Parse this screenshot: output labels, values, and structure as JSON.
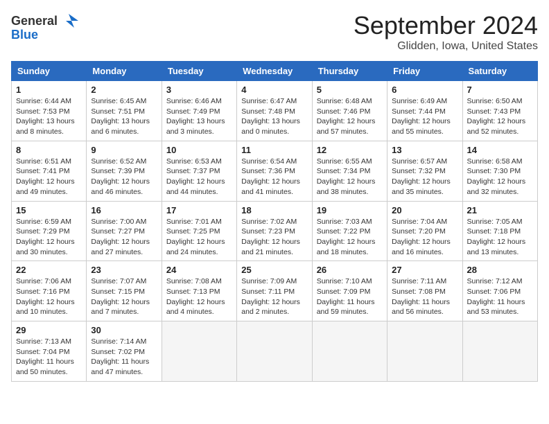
{
  "header": {
    "logo_general": "General",
    "logo_blue": "Blue",
    "month": "September 2024",
    "location": "Glidden, Iowa, United States"
  },
  "columns": [
    "Sunday",
    "Monday",
    "Tuesday",
    "Wednesday",
    "Thursday",
    "Friday",
    "Saturday"
  ],
  "weeks": [
    [
      {
        "day": "1",
        "info": "Sunrise: 6:44 AM\nSunset: 7:53 PM\nDaylight: 13 hours\nand 8 minutes."
      },
      {
        "day": "2",
        "info": "Sunrise: 6:45 AM\nSunset: 7:51 PM\nDaylight: 13 hours\nand 6 minutes."
      },
      {
        "day": "3",
        "info": "Sunrise: 6:46 AM\nSunset: 7:49 PM\nDaylight: 13 hours\nand 3 minutes."
      },
      {
        "day": "4",
        "info": "Sunrise: 6:47 AM\nSunset: 7:48 PM\nDaylight: 13 hours\nand 0 minutes."
      },
      {
        "day": "5",
        "info": "Sunrise: 6:48 AM\nSunset: 7:46 PM\nDaylight: 12 hours\nand 57 minutes."
      },
      {
        "day": "6",
        "info": "Sunrise: 6:49 AM\nSunset: 7:44 PM\nDaylight: 12 hours\nand 55 minutes."
      },
      {
        "day": "7",
        "info": "Sunrise: 6:50 AM\nSunset: 7:43 PM\nDaylight: 12 hours\nand 52 minutes."
      }
    ],
    [
      {
        "day": "8",
        "info": "Sunrise: 6:51 AM\nSunset: 7:41 PM\nDaylight: 12 hours\nand 49 minutes."
      },
      {
        "day": "9",
        "info": "Sunrise: 6:52 AM\nSunset: 7:39 PM\nDaylight: 12 hours\nand 46 minutes."
      },
      {
        "day": "10",
        "info": "Sunrise: 6:53 AM\nSunset: 7:37 PM\nDaylight: 12 hours\nand 44 minutes."
      },
      {
        "day": "11",
        "info": "Sunrise: 6:54 AM\nSunset: 7:36 PM\nDaylight: 12 hours\nand 41 minutes."
      },
      {
        "day": "12",
        "info": "Sunrise: 6:55 AM\nSunset: 7:34 PM\nDaylight: 12 hours\nand 38 minutes."
      },
      {
        "day": "13",
        "info": "Sunrise: 6:57 AM\nSunset: 7:32 PM\nDaylight: 12 hours\nand 35 minutes."
      },
      {
        "day": "14",
        "info": "Sunrise: 6:58 AM\nSunset: 7:30 PM\nDaylight: 12 hours\nand 32 minutes."
      }
    ],
    [
      {
        "day": "15",
        "info": "Sunrise: 6:59 AM\nSunset: 7:29 PM\nDaylight: 12 hours\nand 30 minutes."
      },
      {
        "day": "16",
        "info": "Sunrise: 7:00 AM\nSunset: 7:27 PM\nDaylight: 12 hours\nand 27 minutes."
      },
      {
        "day": "17",
        "info": "Sunrise: 7:01 AM\nSunset: 7:25 PM\nDaylight: 12 hours\nand 24 minutes."
      },
      {
        "day": "18",
        "info": "Sunrise: 7:02 AM\nSunset: 7:23 PM\nDaylight: 12 hours\nand 21 minutes."
      },
      {
        "day": "19",
        "info": "Sunrise: 7:03 AM\nSunset: 7:22 PM\nDaylight: 12 hours\nand 18 minutes."
      },
      {
        "day": "20",
        "info": "Sunrise: 7:04 AM\nSunset: 7:20 PM\nDaylight: 12 hours\nand 16 minutes."
      },
      {
        "day": "21",
        "info": "Sunrise: 7:05 AM\nSunset: 7:18 PM\nDaylight: 12 hours\nand 13 minutes."
      }
    ],
    [
      {
        "day": "22",
        "info": "Sunrise: 7:06 AM\nSunset: 7:16 PM\nDaylight: 12 hours\nand 10 minutes."
      },
      {
        "day": "23",
        "info": "Sunrise: 7:07 AM\nSunset: 7:15 PM\nDaylight: 12 hours\nand 7 minutes."
      },
      {
        "day": "24",
        "info": "Sunrise: 7:08 AM\nSunset: 7:13 PM\nDaylight: 12 hours\nand 4 minutes."
      },
      {
        "day": "25",
        "info": "Sunrise: 7:09 AM\nSunset: 7:11 PM\nDaylight: 12 hours\nand 2 minutes."
      },
      {
        "day": "26",
        "info": "Sunrise: 7:10 AM\nSunset: 7:09 PM\nDaylight: 11 hours\nand 59 minutes."
      },
      {
        "day": "27",
        "info": "Sunrise: 7:11 AM\nSunset: 7:08 PM\nDaylight: 11 hours\nand 56 minutes."
      },
      {
        "day": "28",
        "info": "Sunrise: 7:12 AM\nSunset: 7:06 PM\nDaylight: 11 hours\nand 53 minutes."
      }
    ],
    [
      {
        "day": "29",
        "info": "Sunrise: 7:13 AM\nSunset: 7:04 PM\nDaylight: 11 hours\nand 50 minutes."
      },
      {
        "day": "30",
        "info": "Sunrise: 7:14 AM\nSunset: 7:02 PM\nDaylight: 11 hours\nand 47 minutes."
      },
      {
        "day": "",
        "info": ""
      },
      {
        "day": "",
        "info": ""
      },
      {
        "day": "",
        "info": ""
      },
      {
        "day": "",
        "info": ""
      },
      {
        "day": "",
        "info": ""
      }
    ]
  ]
}
